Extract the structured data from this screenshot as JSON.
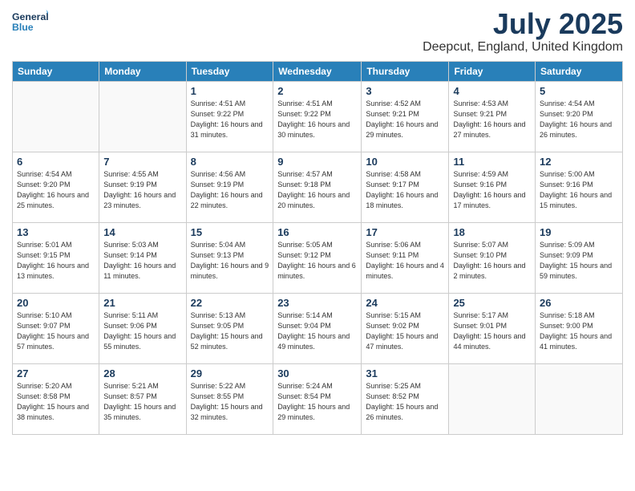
{
  "header": {
    "logo_general": "General",
    "logo_blue": "Blue",
    "title": "July 2025",
    "subtitle": "Deepcut, England, United Kingdom"
  },
  "days_of_week": [
    "Sunday",
    "Monday",
    "Tuesday",
    "Wednesday",
    "Thursday",
    "Friday",
    "Saturday"
  ],
  "weeks": [
    [
      {
        "day": "",
        "info": ""
      },
      {
        "day": "",
        "info": ""
      },
      {
        "day": "1",
        "info": "Sunrise: 4:51 AM\nSunset: 9:22 PM\nDaylight: 16 hours\nand 31 minutes."
      },
      {
        "day": "2",
        "info": "Sunrise: 4:51 AM\nSunset: 9:22 PM\nDaylight: 16 hours\nand 30 minutes."
      },
      {
        "day": "3",
        "info": "Sunrise: 4:52 AM\nSunset: 9:21 PM\nDaylight: 16 hours\nand 29 minutes."
      },
      {
        "day": "4",
        "info": "Sunrise: 4:53 AM\nSunset: 9:21 PM\nDaylight: 16 hours\nand 27 minutes."
      },
      {
        "day": "5",
        "info": "Sunrise: 4:54 AM\nSunset: 9:20 PM\nDaylight: 16 hours\nand 26 minutes."
      }
    ],
    [
      {
        "day": "6",
        "info": "Sunrise: 4:54 AM\nSunset: 9:20 PM\nDaylight: 16 hours\nand 25 minutes."
      },
      {
        "day": "7",
        "info": "Sunrise: 4:55 AM\nSunset: 9:19 PM\nDaylight: 16 hours\nand 23 minutes."
      },
      {
        "day": "8",
        "info": "Sunrise: 4:56 AM\nSunset: 9:19 PM\nDaylight: 16 hours\nand 22 minutes."
      },
      {
        "day": "9",
        "info": "Sunrise: 4:57 AM\nSunset: 9:18 PM\nDaylight: 16 hours\nand 20 minutes."
      },
      {
        "day": "10",
        "info": "Sunrise: 4:58 AM\nSunset: 9:17 PM\nDaylight: 16 hours\nand 18 minutes."
      },
      {
        "day": "11",
        "info": "Sunrise: 4:59 AM\nSunset: 9:16 PM\nDaylight: 16 hours\nand 17 minutes."
      },
      {
        "day": "12",
        "info": "Sunrise: 5:00 AM\nSunset: 9:16 PM\nDaylight: 16 hours\nand 15 minutes."
      }
    ],
    [
      {
        "day": "13",
        "info": "Sunrise: 5:01 AM\nSunset: 9:15 PM\nDaylight: 16 hours\nand 13 minutes."
      },
      {
        "day": "14",
        "info": "Sunrise: 5:03 AM\nSunset: 9:14 PM\nDaylight: 16 hours\nand 11 minutes."
      },
      {
        "day": "15",
        "info": "Sunrise: 5:04 AM\nSunset: 9:13 PM\nDaylight: 16 hours\nand 9 minutes."
      },
      {
        "day": "16",
        "info": "Sunrise: 5:05 AM\nSunset: 9:12 PM\nDaylight: 16 hours\nand 6 minutes."
      },
      {
        "day": "17",
        "info": "Sunrise: 5:06 AM\nSunset: 9:11 PM\nDaylight: 16 hours\nand 4 minutes."
      },
      {
        "day": "18",
        "info": "Sunrise: 5:07 AM\nSunset: 9:10 PM\nDaylight: 16 hours\nand 2 minutes."
      },
      {
        "day": "19",
        "info": "Sunrise: 5:09 AM\nSunset: 9:09 PM\nDaylight: 15 hours\nand 59 minutes."
      }
    ],
    [
      {
        "day": "20",
        "info": "Sunrise: 5:10 AM\nSunset: 9:07 PM\nDaylight: 15 hours\nand 57 minutes."
      },
      {
        "day": "21",
        "info": "Sunrise: 5:11 AM\nSunset: 9:06 PM\nDaylight: 15 hours\nand 55 minutes."
      },
      {
        "day": "22",
        "info": "Sunrise: 5:13 AM\nSunset: 9:05 PM\nDaylight: 15 hours\nand 52 minutes."
      },
      {
        "day": "23",
        "info": "Sunrise: 5:14 AM\nSunset: 9:04 PM\nDaylight: 15 hours\nand 49 minutes."
      },
      {
        "day": "24",
        "info": "Sunrise: 5:15 AM\nSunset: 9:02 PM\nDaylight: 15 hours\nand 47 minutes."
      },
      {
        "day": "25",
        "info": "Sunrise: 5:17 AM\nSunset: 9:01 PM\nDaylight: 15 hours\nand 44 minutes."
      },
      {
        "day": "26",
        "info": "Sunrise: 5:18 AM\nSunset: 9:00 PM\nDaylight: 15 hours\nand 41 minutes."
      }
    ],
    [
      {
        "day": "27",
        "info": "Sunrise: 5:20 AM\nSunset: 8:58 PM\nDaylight: 15 hours\nand 38 minutes."
      },
      {
        "day": "28",
        "info": "Sunrise: 5:21 AM\nSunset: 8:57 PM\nDaylight: 15 hours\nand 35 minutes."
      },
      {
        "day": "29",
        "info": "Sunrise: 5:22 AM\nSunset: 8:55 PM\nDaylight: 15 hours\nand 32 minutes."
      },
      {
        "day": "30",
        "info": "Sunrise: 5:24 AM\nSunset: 8:54 PM\nDaylight: 15 hours\nand 29 minutes."
      },
      {
        "day": "31",
        "info": "Sunrise: 5:25 AM\nSunset: 8:52 PM\nDaylight: 15 hours\nand 26 minutes."
      },
      {
        "day": "",
        "info": ""
      },
      {
        "day": "",
        "info": ""
      }
    ]
  ]
}
